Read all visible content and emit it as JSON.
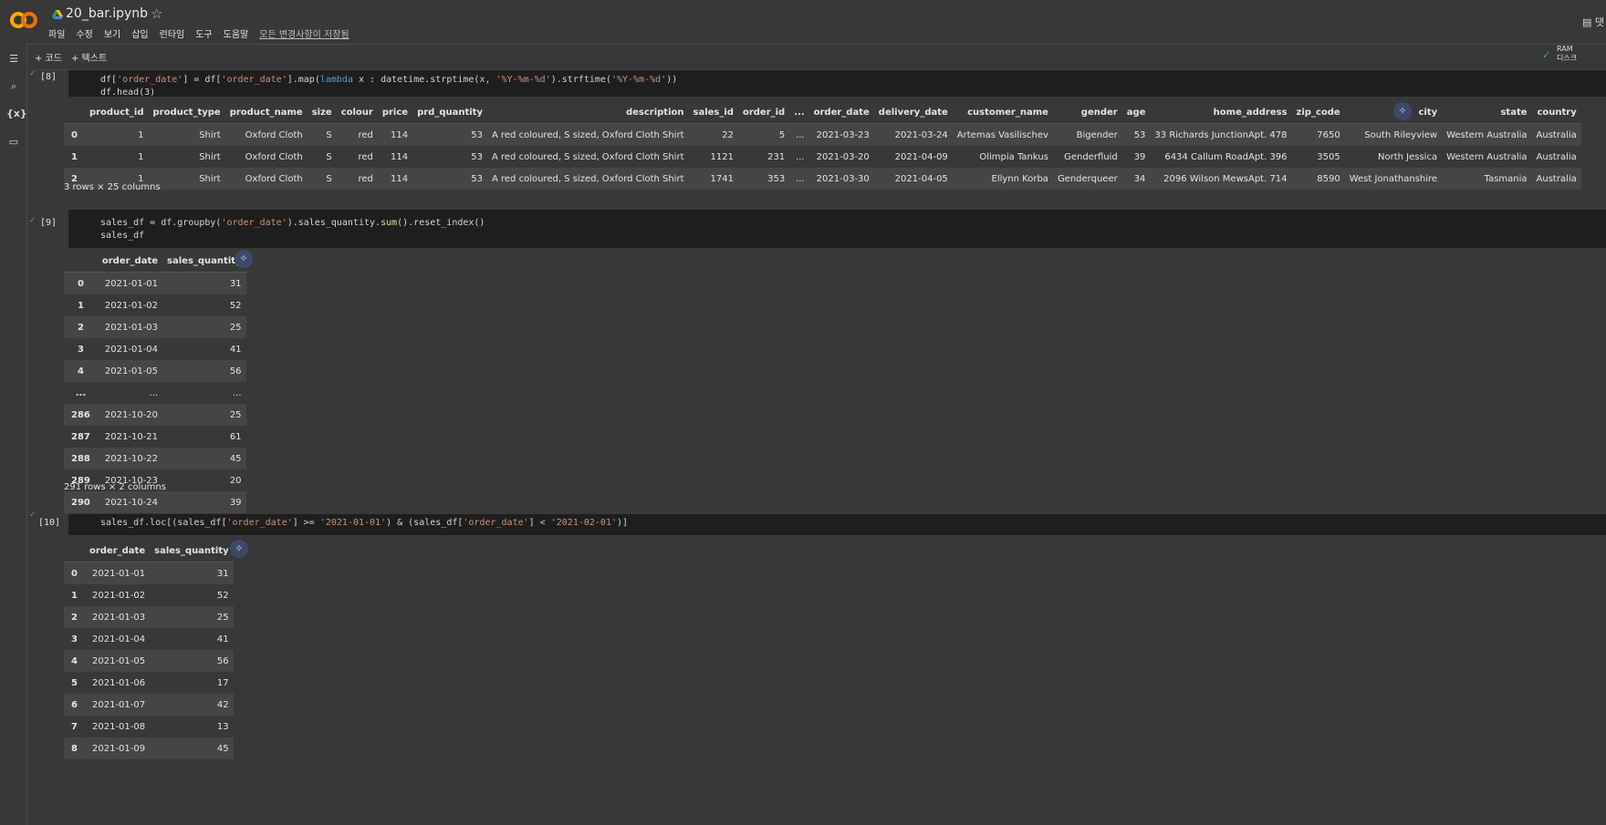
{
  "header": {
    "title": "20_bar.ipynb",
    "menu": [
      "파일",
      "수정",
      "보기",
      "삽입",
      "런타임",
      "도구",
      "도움말"
    ],
    "saved": "모든 변경사항이 저장됨",
    "comment_label": "댓"
  },
  "toolbar": {
    "add_code": "+ 코드",
    "add_text": "+ 텍스트",
    "ram_label": "RAM",
    "disk_label": "디스크"
  },
  "cells": {
    "c8": {
      "number": "[8]",
      "line2": "df.head(3)",
      "table": {
        "columns": [
          "",
          "product_id",
          "product_type",
          "product_name",
          "size",
          "colour",
          "price",
          "prd_quantity",
          "description",
          "sales_id",
          "order_id",
          "...",
          "order_date",
          "delivery_date",
          "customer_name",
          "gender",
          "age",
          "home_address",
          "zip_code",
          "city",
          "state",
          "country"
        ],
        "rows": [
          [
            "0",
            "1",
            "Shirt",
            "Oxford Cloth",
            "S",
            "red",
            "114",
            "53",
            "A red coloured, S sized, Oxford Cloth Shirt",
            "22",
            "5",
            "...",
            "2021-03-23",
            "2021-03-24",
            "Artemas Vasilischev",
            "Bigender",
            "53",
            "33 Richards JunctionApt. 478",
            "7650",
            "South Rileyview",
            "Western Australia",
            "Australia"
          ],
          [
            "1",
            "1",
            "Shirt",
            "Oxford Cloth",
            "S",
            "red",
            "114",
            "53",
            "A red coloured, S sized, Oxford Cloth Shirt",
            "1121",
            "231",
            "...",
            "2021-03-20",
            "2021-04-09",
            "Olimpia Tankus",
            "Genderfluid",
            "39",
            "6434 Callum RoadApt. 396",
            "3505",
            "North Jessica",
            "Western Australia",
            "Australia"
          ],
          [
            "2",
            "1",
            "Shirt",
            "Oxford Cloth",
            "S",
            "red",
            "114",
            "53",
            "A red coloured, S sized, Oxford Cloth Shirt",
            "1741",
            "353",
            "...",
            "2021-03-30",
            "2021-04-05",
            "Ellynn Korba",
            "Genderqueer",
            "34",
            "2096 Wilson MewsApt. 714",
            "8590",
            "West Jonathanshire",
            "Tasmania",
            "Australia"
          ]
        ]
      },
      "shape": "3 rows × 25 columns"
    },
    "c9": {
      "number": "[9]",
      "line2": "sales_df",
      "table": {
        "columns": [
          "",
          "order_date",
          "sales_quantity"
        ],
        "rows": [
          [
            "0",
            "2021-01-01",
            "31"
          ],
          [
            "1",
            "2021-01-02",
            "52"
          ],
          [
            "2",
            "2021-01-03",
            "25"
          ],
          [
            "3",
            "2021-01-04",
            "41"
          ],
          [
            "4",
            "2021-01-05",
            "56"
          ],
          [
            "...",
            "...",
            "..."
          ],
          [
            "286",
            "2021-10-20",
            "25"
          ],
          [
            "287",
            "2021-10-21",
            "61"
          ],
          [
            "288",
            "2021-10-22",
            "45"
          ],
          [
            "289",
            "2021-10-23",
            "20"
          ],
          [
            "290",
            "2021-10-24",
            "39"
          ]
        ]
      },
      "shape": "291 rows × 2 columns"
    },
    "c10": {
      "number": "[10]",
      "table": {
        "columns": [
          "",
          "order_date",
          "sales_quantity"
        ],
        "rows": [
          [
            "0",
            "2021-01-01",
            "31"
          ],
          [
            "1",
            "2021-01-02",
            "52"
          ],
          [
            "2",
            "2021-01-03",
            "25"
          ],
          [
            "3",
            "2021-01-04",
            "41"
          ],
          [
            "4",
            "2021-01-05",
            "56"
          ],
          [
            "5",
            "2021-01-06",
            "17"
          ],
          [
            "6",
            "2021-01-07",
            "42"
          ],
          [
            "7",
            "2021-01-08",
            "13"
          ],
          [
            "8",
            "2021-01-09",
            "45"
          ]
        ]
      }
    }
  }
}
